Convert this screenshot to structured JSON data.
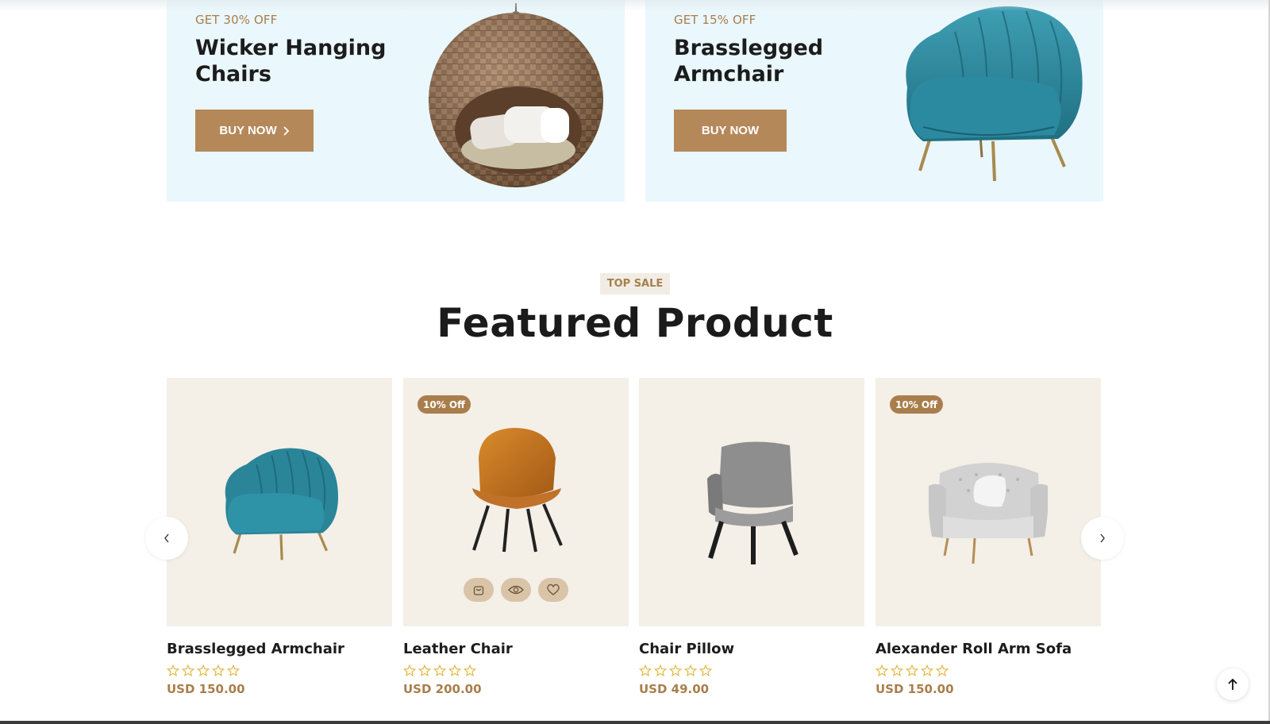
{
  "banners": [
    {
      "discount": "GET 30% OFF",
      "title": "Wicker Hanging Chairs",
      "button": "BUY NOW",
      "has_chevron": true,
      "image": "wicker-hanging-chair-image"
    },
    {
      "discount": "GET 15% OFF",
      "title": "Brasslegged Armchair",
      "button": "BUY NOW",
      "has_chevron": false,
      "image": "teal-armchair-image"
    }
  ],
  "section": {
    "tag": "TOP SALE",
    "title": "Featured Product"
  },
  "products": [
    {
      "name": "Brasslegged Armchair",
      "price": "USD 150.00",
      "badge": "",
      "rating": 0,
      "image": "teal-armchair-image"
    },
    {
      "name": "Leather Chair",
      "price": "USD 200.00",
      "badge": "10% Off",
      "rating": 0,
      "image": "leather-chair-image"
    },
    {
      "name": "Chair Pillow",
      "price": "USD 49.00",
      "badge": "",
      "rating": 0,
      "image": "grey-chair-image"
    },
    {
      "name": "Alexander Roll Arm Sofa",
      "price": "USD 150.00",
      "badge": "10% Off",
      "rating": 0,
      "image": "white-sofa-chair-image"
    }
  ],
  "card_actions": [
    "cart-icon",
    "eye-icon",
    "heart-icon"
  ],
  "colors": {
    "accent": "#b5885a",
    "banner_bg": "#eaf7fc",
    "card_bg": "#f4efe7",
    "star": "#e0b43a",
    "tag_bg": "#f2ede4"
  }
}
